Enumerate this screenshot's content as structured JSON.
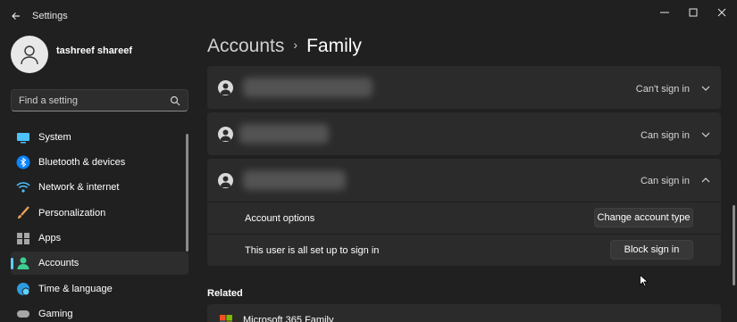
{
  "window": {
    "title": "Settings"
  },
  "profile": {
    "name": "tashreef shareef"
  },
  "search": {
    "placeholder": "Find a setting"
  },
  "sidebar": {
    "items": [
      {
        "label": "System",
        "icon": "system-icon"
      },
      {
        "label": "Bluetooth & devices",
        "icon": "bluetooth-icon"
      },
      {
        "label": "Network & internet",
        "icon": "wifi-icon"
      },
      {
        "label": "Personalization",
        "icon": "brush-icon"
      },
      {
        "label": "Apps",
        "icon": "apps-icon"
      },
      {
        "label": "Accounts",
        "icon": "accounts-icon",
        "selected": true
      },
      {
        "label": "Time & language",
        "icon": "globe-clock-icon"
      },
      {
        "label": "Gaming",
        "icon": "gamepad-icon"
      }
    ]
  },
  "breadcrumb": {
    "parent": "Accounts",
    "separator": "›",
    "current": "Family"
  },
  "members": [
    {
      "status": "Can't sign in",
      "expanded": false
    },
    {
      "status": "Can sign in",
      "expanded": false
    },
    {
      "status": "Can sign in",
      "expanded": true
    }
  ],
  "expanded_member": {
    "options_label": "Account options",
    "options_button": "Change account type",
    "signin_label": "This user is all set up to sign in",
    "signin_button": "Block sign in"
  },
  "related": {
    "heading": "Related",
    "item_label": "Microsoft 365 Family"
  },
  "colors": {
    "background": "#202020",
    "card": "#2b2b2b",
    "accent": "#60cdff"
  }
}
